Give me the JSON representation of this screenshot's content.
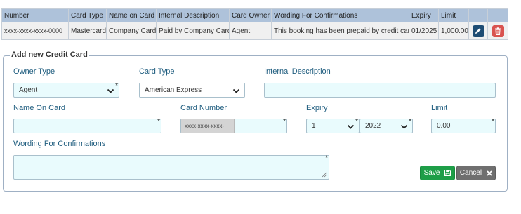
{
  "table": {
    "headers": [
      "Number",
      "Card Type",
      "Name on Card",
      "Internal Description",
      "Card Owner",
      "Wording For Confirmations",
      "Expiry",
      "Limit"
    ],
    "rows": [
      {
        "number": "xxxx-xxxx-xxxx-0000",
        "card_type": "Mastercard",
        "name_on_card": "Company Card",
        "internal_description": "Paid by Company Card",
        "card_owner": "Agent",
        "wording": "This booking has been prepaid by credit card",
        "expiry": "01/2025",
        "limit": "1,000.00"
      }
    ],
    "actions": {
      "edit_icon": "pencil-icon",
      "delete_icon": "trash-icon"
    }
  },
  "form": {
    "legend": "Add new Credit Card",
    "owner_type": {
      "label": "Owner Type",
      "value": "Agent"
    },
    "card_type": {
      "label": "Card Type",
      "value": "American Express"
    },
    "internal_description": {
      "label": "Internal Description",
      "value": ""
    },
    "name_on_card": {
      "label": "Name On Card",
      "value": ""
    },
    "card_number": {
      "label": "Card Number",
      "prefix": "xxxx-xxxx-xxxx-",
      "value": ""
    },
    "expiry": {
      "label": "Expiry",
      "month": "1",
      "year": "2022"
    },
    "limit": {
      "label": "Limit",
      "value": "0.00"
    },
    "wording": {
      "label": "Wording For Confirmations",
      "value": ""
    },
    "required_mark": "*",
    "save_label": "Save",
    "cancel_label": "Cancel"
  },
  "colors": {
    "header_bg": "#aec2da",
    "field_bg": "#e9fbfd",
    "label": "#1f5d7f",
    "save": "#1e9e48",
    "cancel": "#6f6f6f",
    "edit": "#1e4c73",
    "delete": "#d9534f"
  }
}
